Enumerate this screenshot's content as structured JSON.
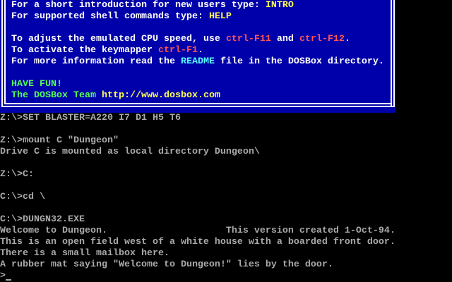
{
  "colors": {
    "box_bg": "#0000AA",
    "white": "#FFFFFF",
    "yellow": "#FFFF55",
    "red": "#FF5555",
    "green": "#55FF55",
    "cyan": "#55FFFF",
    "gray": "#AAAAAA"
  },
  "welcome_box": {
    "lines": [
      {
        "row": 0,
        "segments": [
          {
            "t": "For a short introduction for new users type: ",
            "c": "white"
          },
          {
            "t": "INTRO",
            "c": "yellow"
          }
        ]
      },
      {
        "row": 1,
        "segments": [
          {
            "t": "For supported shell commands type: ",
            "c": "white"
          },
          {
            "t": "HELP",
            "c": "yellow"
          }
        ]
      },
      {
        "row": 3,
        "segments": [
          {
            "t": "To adjust the emulated CPU speed, use ",
            "c": "white"
          },
          {
            "t": "ctrl-F11",
            "c": "red"
          },
          {
            "t": " and ",
            "c": "white"
          },
          {
            "t": "ctrl-F12",
            "c": "red"
          },
          {
            "t": ".",
            "c": "white"
          }
        ]
      },
      {
        "row": 4,
        "segments": [
          {
            "t": "To activate the keymapper ",
            "c": "white"
          },
          {
            "t": "ctrl-F1",
            "c": "red"
          },
          {
            "t": ".",
            "c": "white"
          }
        ]
      },
      {
        "row": 5,
        "segments": [
          {
            "t": "For more information read the ",
            "c": "white"
          },
          {
            "t": "README",
            "c": "cyan"
          },
          {
            "t": " file in the DOSBox directory.",
            "c": "white"
          }
        ]
      },
      {
        "row": 7,
        "segments": [
          {
            "t": "HAVE FUN!",
            "c": "green"
          }
        ]
      },
      {
        "row": 8,
        "segments": [
          {
            "t": "The DOSBox Team ",
            "c": "green"
          },
          {
            "t": "http://www.dosbox.com",
            "c": "yellow"
          }
        ]
      }
    ]
  },
  "console": {
    "lines": [
      {
        "row": 10,
        "text": "Z:\\>SET BLASTER=A220 I7 D1 H5 T6"
      },
      {
        "row": 12,
        "text": "Z:\\>mount C \"Dungeon\""
      },
      {
        "row": 13,
        "text": "Drive C is mounted as local directory Dungeon\\"
      },
      {
        "row": 15,
        "text": "Z:\\>C:"
      },
      {
        "row": 17,
        "text": "C:\\>cd \\"
      },
      {
        "row": 19,
        "text": "C:\\>DUNGN32.EXE"
      },
      {
        "row": 20,
        "text": "Welcome to Dungeon.                     This version created 1-Oct-94."
      },
      {
        "row": 21,
        "text": "This is an open field west of a white house with a boarded front door."
      },
      {
        "row": 22,
        "text": "There is a small mailbox here."
      },
      {
        "row": 23,
        "text": "A rubber mat saying \"Welcome to Dungeon!\" lies by the door."
      }
    ],
    "prompt": ">"
  }
}
